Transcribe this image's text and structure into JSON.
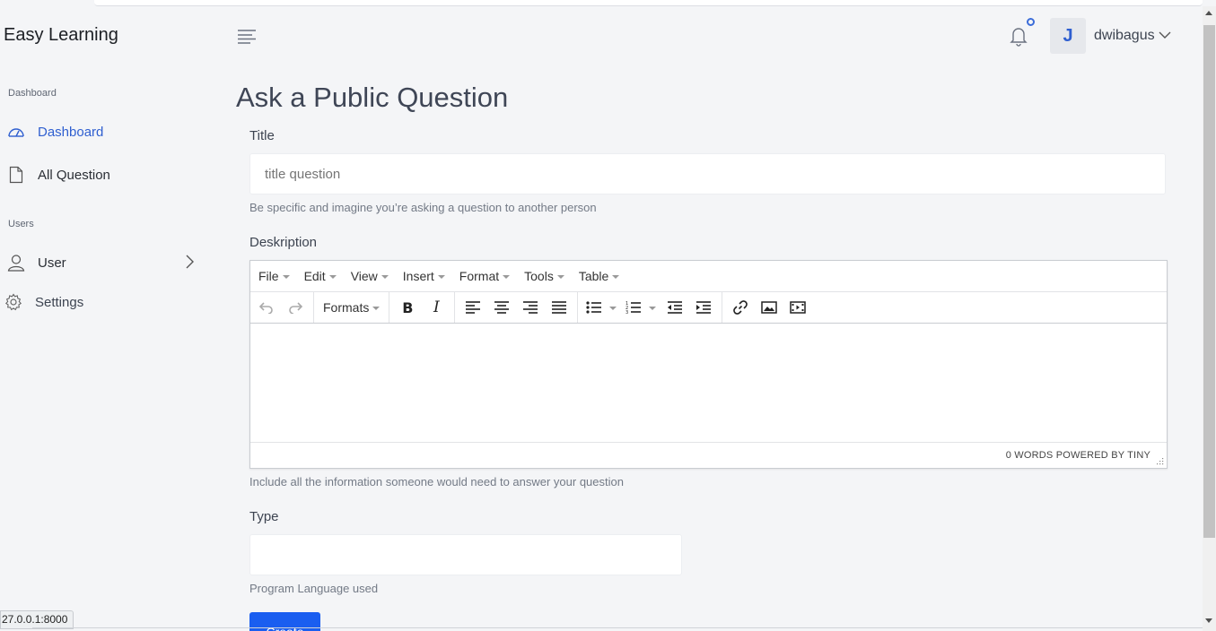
{
  "app": {
    "brand": "Easy Learning"
  },
  "sidebar": {
    "sections": [
      {
        "label": "Dashboard"
      },
      {
        "label": "Users"
      }
    ],
    "items": [
      {
        "label": "Dashboard",
        "icon": "dashboard-gauge-icon",
        "active": true
      },
      {
        "label": "All Question",
        "icon": "document-icon"
      },
      {
        "label": "User",
        "icon": "user-icon",
        "has_submenu": true
      },
      {
        "label": "Settings",
        "icon": "gear-icon"
      }
    ]
  },
  "header": {
    "user_initial": "J",
    "username": "dwibagus"
  },
  "page": {
    "title": "Ask a Public Question"
  },
  "form": {
    "title_label": "Title",
    "title_placeholder": "title question",
    "title_help": "Be specific and imagine you’re asking a question to another person",
    "desc_label": "Deskription",
    "desc_help": "Include all the information someone would need to answer your question",
    "type_label": "Type",
    "type_value": "",
    "type_help": "Program Language used",
    "submit_label": "Create"
  },
  "editor": {
    "menus": [
      "File",
      "Edit",
      "View",
      "Insert",
      "Format",
      "Tools",
      "Table"
    ],
    "formats_label": "Formats",
    "status": "0 WORDS POWERED BY TINY"
  },
  "browser": {
    "status_url": "27.0.0.1:8000"
  },
  "colors": {
    "accent": "#2f5fd0",
    "button": "#1a5ef0",
    "background": "#f4f5f7"
  }
}
